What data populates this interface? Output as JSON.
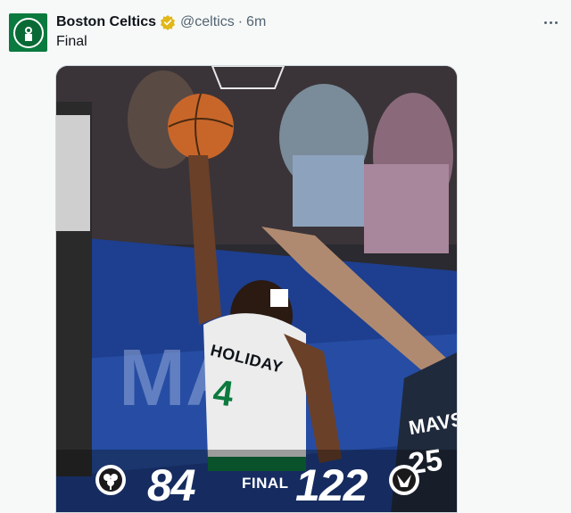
{
  "tweet": {
    "author_name": "Boston Celtics",
    "handle": "@celtics",
    "separator": "·",
    "time": "6m",
    "text": "Final"
  },
  "media": {
    "player_jersey_name": "HOLIDAY",
    "player_jersey_number": "4",
    "opponent_jersey_name": "MAVS",
    "opponent_jersey_number": "25",
    "scoreboard": {
      "home_score": "84",
      "status": "FINAL",
      "away_score": "122",
      "home_team_icon": "celtics-logo-icon",
      "away_team_icon": "mavericks-logo-icon"
    }
  },
  "icons": {
    "verified": "verified-badge-icon",
    "more": "more-options-icon"
  },
  "colors": {
    "celtics_green": "#0b7a3e",
    "verified_gold": "#e2b719",
    "handle_gray": "#536471",
    "court_blue": "#1e3f8f"
  }
}
